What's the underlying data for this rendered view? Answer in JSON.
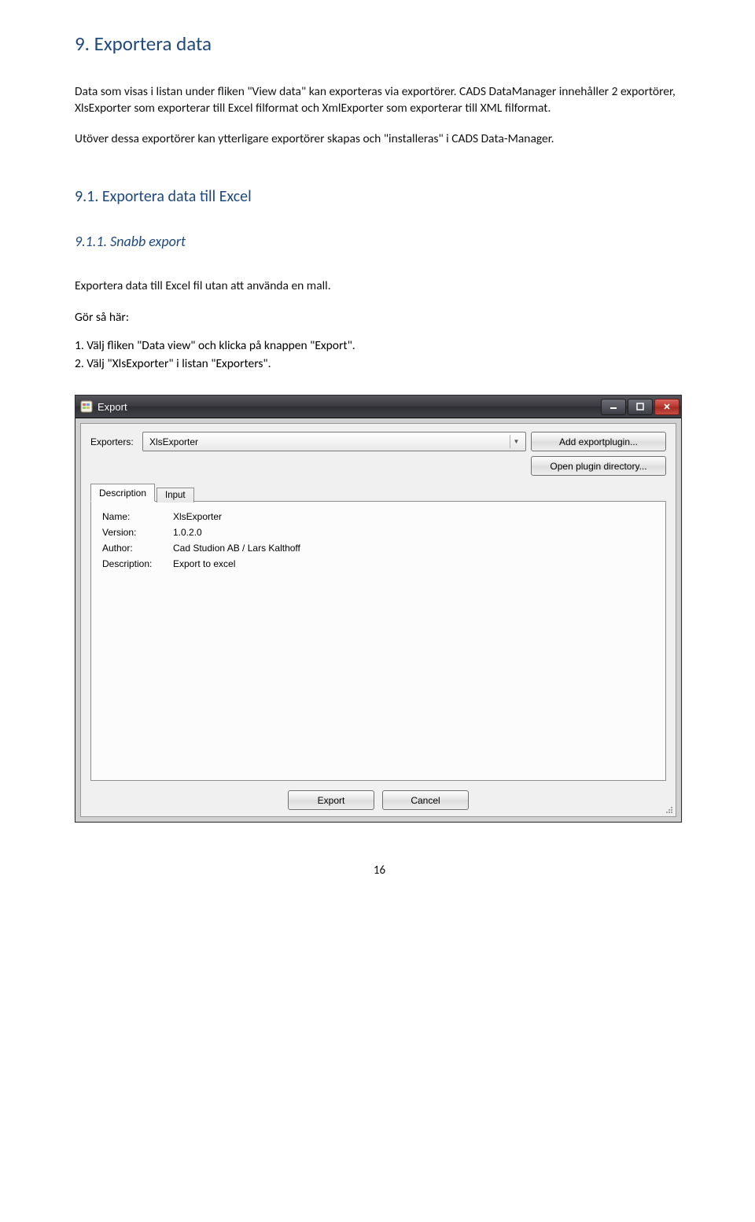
{
  "doc": {
    "h1": "9.  Exportera data",
    "p1": "Data som visas i listan under fliken \"View data\" kan exporteras via exportörer. CADS DataManager innehåller 2 exportörer, XlsExporter som exporterar till Excel filformat och XmlExporter som exporterar till XML filformat.",
    "p2": "Utöver dessa exportörer kan ytterligare exportörer skapas och \"installeras\" i CADS Data-Manager.",
    "h2": "9.1. Exportera data till Excel",
    "h3": "9.1.1. Snabb export",
    "p3": "Exportera data till Excel fil utan att använda en mall.",
    "steps_title": "Gör så här:",
    "step1": "1.  Välj fliken \"Data view\" och klicka på knappen \"Export\".",
    "step2": "2.  Välj \"XlsExporter\" i listan \"Exporters\".",
    "page_number": "16"
  },
  "window": {
    "title": "Export",
    "exporters_label": "Exporters:",
    "exporters_value": "XlsExporter",
    "btn_add": "Add exportplugin...",
    "btn_open": "Open plugin directory...",
    "tabs": {
      "description": "Description",
      "input": "Input"
    },
    "fields": {
      "name_label": "Name:",
      "name_value": "XlsExporter",
      "version_label": "Version:",
      "version_value": "1.0.2.0",
      "author_label": "Author:",
      "author_value": "Cad Studion AB / Lars Kalthoff",
      "desc_label": "Description:",
      "desc_value": "Export to excel"
    },
    "btn_export": "Export",
    "btn_cancel": "Cancel"
  }
}
